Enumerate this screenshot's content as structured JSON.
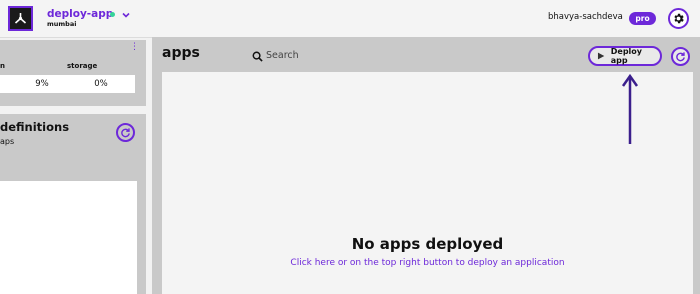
{
  "header": {
    "app_name": "deploy-app",
    "region": "mumbai",
    "username": "bhavya-sachdeva",
    "plan_badge": "pro",
    "status_color": "#34d399"
  },
  "left_panel_stats": {
    "stat1_label": "n",
    "stat1_value": "9%",
    "stat2_label": "storage",
    "stat2_value": "0%"
  },
  "left_panel_definitions": {
    "title": "definitions",
    "subtitle": "aps"
  },
  "main": {
    "title": "apps",
    "search_placeholder": "Search",
    "deploy_button": "Deploy app",
    "empty_title": "No apps deployed",
    "empty_subtitle": "Click here or on the top right button to deploy an application"
  },
  "colors": {
    "accent": "#6d28d9",
    "panel_bg": "#c9c9c9"
  },
  "icons": [
    "logo-icon",
    "chevron-down-icon",
    "gear-icon",
    "more-vertical-icon",
    "refresh-icon",
    "search-icon",
    "play-icon",
    "arrow-up-annotation"
  ]
}
